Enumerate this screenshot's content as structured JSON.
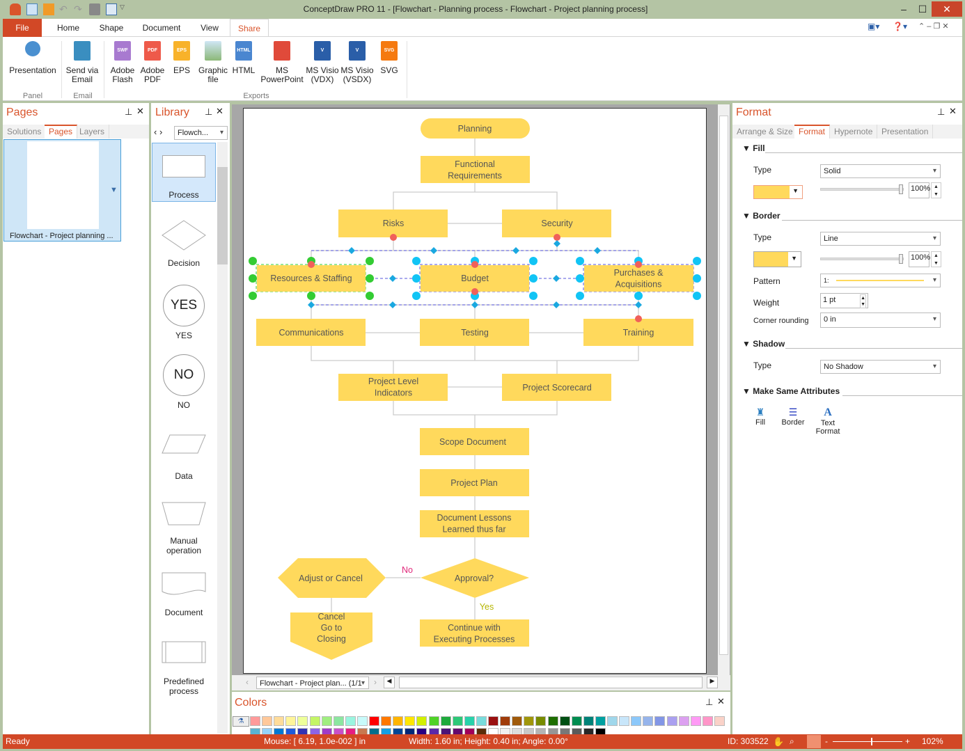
{
  "app": {
    "title": "ConceptDraw PRO 11 - [Flowchart - Planning process - Flowchart - Project planning process]"
  },
  "menu_tabs": [
    {
      "label": "File"
    },
    {
      "label": "Home"
    },
    {
      "label": "Shape"
    },
    {
      "label": "Document"
    },
    {
      "label": "View"
    },
    {
      "label": "Share"
    }
  ],
  "ribbon": {
    "buttons": [
      {
        "label": "Presentation",
        "icon": "presentation-icon"
      },
      {
        "label": "Send via Email",
        "icon": "email-icon"
      },
      {
        "label": "Adobe Flash",
        "icon": "SWF"
      },
      {
        "label": "Adobe PDF",
        "icon": "PDF"
      },
      {
        "label": "EPS",
        "icon": "EPS"
      },
      {
        "label": "Graphic file",
        "icon": "image-icon"
      },
      {
        "label": "HTML",
        "icon": "HTML"
      },
      {
        "label": "MS PowerPoint",
        "icon": "powerpoint-icon"
      },
      {
        "label": "MS Visio (VDX)",
        "icon": "visio-icon"
      },
      {
        "label": "MS Visio (VSDX)",
        "icon": "visio-icon"
      },
      {
        "label": "SVG",
        "icon": "SVG"
      }
    ],
    "groups": [
      "Panel",
      "Email",
      "Exports"
    ]
  },
  "pages_panel": {
    "title": "Pages",
    "tabs": [
      "Solutions",
      "Pages",
      "Layers"
    ],
    "page_name": "Flowchart - Project planning ..."
  },
  "library_panel": {
    "title": "Library",
    "dropdown": "Flowch...",
    "items": [
      "Process",
      "Decision",
      "YES",
      "NO",
      "Data",
      "Manual operation",
      "Document",
      "Predefined process"
    ],
    "yes_glyph": "YES",
    "no_glyph": "NO"
  },
  "diagram": {
    "nodes": {
      "planning": "Planning",
      "func_req": "Functional Requirements",
      "risks": "Risks",
      "security": "Security",
      "resources": "Resources & Staffing",
      "budget": "Budget",
      "purchases": "Purchases & Acquisitions",
      "communications": "Communications",
      "testing": "Testing",
      "training": "Training",
      "pli": "Project Level Indicators",
      "scorecard": "Project Scorecard",
      "scope": "Scope Document",
      "plan": "Project Plan",
      "lessons": "Document Lessons Learned thus far",
      "approval": "Approval?",
      "adjust": "Adjust or Cancel",
      "cancel": "Cancel Go to Closing",
      "continue": "Continue with Executing Processes"
    },
    "labels": {
      "no": "No",
      "yes": "Yes"
    },
    "colors": {
      "fill": "#FFD95C",
      "connector": "#cccccc",
      "no": "#e0287a",
      "yes": "#b5b500"
    }
  },
  "page_nav": {
    "value": "Flowchart - Project plan... (1/1"
  },
  "colors_panel": {
    "title": "Colors",
    "swatches_row1": [
      "#ff9a9a",
      "#ffc89a",
      "#ffdc9a",
      "#fff59a",
      "#eeff9a",
      "#c4f566",
      "#a0ee80",
      "#8ce6a0",
      "#9af5e0",
      "#c8fafa",
      "#ff0000",
      "#ff7800",
      "#ffb400",
      "#ffe600",
      "#d2f000",
      "#50d228",
      "#1eaa3c",
      "#2dc878",
      "#28d2aa",
      "#78dcdc",
      "#9a1010",
      "#a03c0a",
      "#a05a0a",
      "#a0960a",
      "#788c00",
      "#1e6e00",
      "#005014",
      "#008c50",
      "#008278",
      "#00a0a0",
      "#a0d7eb",
      "#c8e6fa",
      "#8cc8fa",
      "#96b4eb",
      "#8296e6",
      "#aaa0f0",
      "#dca0f0",
      "#ff9af5",
      "#ff96c8",
      "#fad2c8"
    ],
    "swatches_row2": [
      "#5ab4d2",
      "#96d2fa",
      "#0078d2",
      "#1e5adc",
      "#3232b4",
      "#8c64e6",
      "#a03cc8",
      "#c850c8",
      "#e61e82",
      "#c87850",
      "#006e8c",
      "#14a0e6",
      "#004696",
      "#002878",
      "#280082",
      "#5a28aa",
      "#4b1478",
      "#640a6e",
      "#a0005a",
      "#5a2d0a",
      "#ffffff",
      "#f0f0f0",
      "#dcdcdc",
      "#c8c8c8",
      "#b4b4b4",
      "#969696",
      "#787878",
      "#5a5a5a",
      "#282828",
      "#000000"
    ]
  },
  "format_panel": {
    "title": "Format",
    "tabs": [
      "Arrange & Size",
      "Format",
      "Hypernote",
      "Presentation"
    ],
    "fill": {
      "header": "Fill",
      "type_label": "Type",
      "type": "Solid",
      "color": "#FFD95C",
      "opacity": "100%"
    },
    "border": {
      "header": "Border",
      "type_label": "Type",
      "type": "Line",
      "color": "#FFD95C",
      "opacity": "100%",
      "pattern_label": "Pattern",
      "pattern": "1:",
      "weight_label": "Weight",
      "weight": "1 pt",
      "rounding_label": "Corner rounding",
      "rounding": "0 in"
    },
    "shadow": {
      "header": "Shadow",
      "type_label": "Type",
      "type": "No Shadow"
    },
    "same": {
      "header": "Make Same Attributes",
      "buttons": [
        "Fill",
        "Border",
        "Text Format"
      ]
    }
  },
  "status": {
    "ready": "Ready",
    "mouse": "Mouse: [ 6.19, 1.0e-002 ] in",
    "size": "Width: 1.60 in;  Height: 0.40 in;  Angle: 0.00°",
    "id": "ID: 303522",
    "zoom": "102%",
    "zoom_level": 0.55
  }
}
